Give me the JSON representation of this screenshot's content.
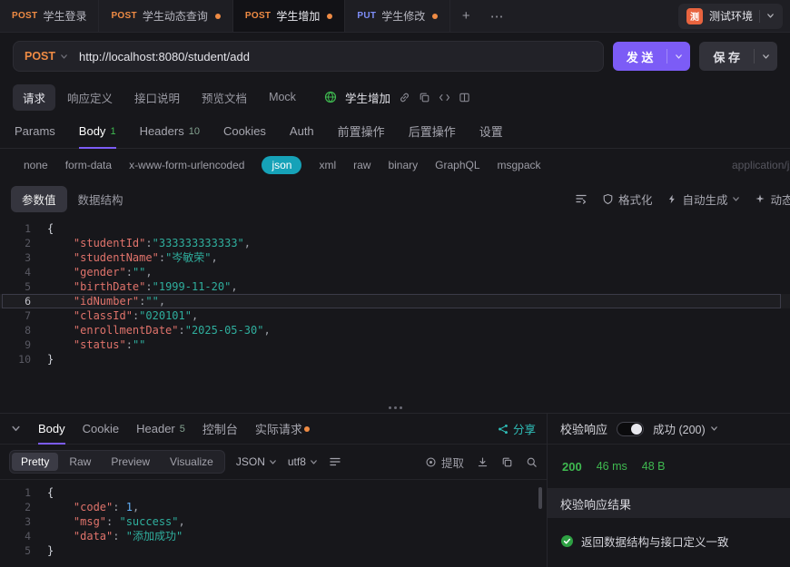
{
  "colors": {
    "accent_purple": "#7c5cf6",
    "method_post": "#ef8b44",
    "method_put": "#7e8ef8",
    "success_green": "#3fb950",
    "json_pill": "#16a2b8",
    "share_teal": "#2fbfb9",
    "dirty_dot": "#ef8b44",
    "env_badge": "#e8643f",
    "token_key": "#e0736b",
    "token_string": "#2fae9d",
    "token_number": "#61aef5",
    "token_punct": "#9da0a8",
    "token_brace": "#cfd2d9"
  },
  "window_tabs": {
    "tabs": [
      {
        "method": "POST",
        "title": "学生登录",
        "dirty": false,
        "active": false
      },
      {
        "method": "POST",
        "title": "学生动态查询",
        "dirty": true,
        "active": false
      },
      {
        "method": "POST",
        "title": "学生增加",
        "dirty": true,
        "active": true
      },
      {
        "method": "PUT",
        "title": "学生修改",
        "dirty": true,
        "active": false
      }
    ],
    "add_button": "+",
    "more_button": "⋯",
    "environment": {
      "badge": "测",
      "name": "测试环境"
    }
  },
  "request_bar": {
    "method": "POST",
    "url": "http://localhost:8080/student/add",
    "send_label": "发 送",
    "save_label": "保 存"
  },
  "doc_nav": {
    "items": [
      {
        "label": "请求",
        "active": true
      },
      {
        "label": "响应定义",
        "active": false
      },
      {
        "label": "接口说明",
        "active": false
      },
      {
        "label": "预览文档",
        "active": false
      },
      {
        "label": "Mock",
        "active": false
      }
    ],
    "endpoint_name": "学生增加"
  },
  "request_tabs": [
    {
      "label": "Params",
      "count": "",
      "active": false
    },
    {
      "label": "Body",
      "count": "1",
      "active": true
    },
    {
      "label": "Headers",
      "count": "10",
      "active": false
    },
    {
      "label": "Cookies",
      "count": "",
      "active": false
    },
    {
      "label": "Auth",
      "count": "",
      "active": false
    },
    {
      "label": "前置操作",
      "count": "",
      "active": false
    },
    {
      "label": "后置操作",
      "count": "",
      "active": false
    },
    {
      "label": "设置",
      "count": "",
      "active": false
    }
  ],
  "body_type_tabs": [
    {
      "label": "none",
      "active": false
    },
    {
      "label": "form-data",
      "active": false
    },
    {
      "label": "x-www-form-urlencoded",
      "active": false
    },
    {
      "label": "json",
      "active": true
    },
    {
      "label": "xml",
      "active": false
    },
    {
      "label": "raw",
      "active": false
    },
    {
      "label": "binary",
      "active": false
    },
    {
      "label": "GraphQL",
      "active": false
    },
    {
      "label": "msgpack",
      "active": false
    }
  ],
  "content_type_hint": "application/json",
  "editor_toolbar": {
    "value_tab": "参数值",
    "schema_tab": "数据结构",
    "format_label": "格式化",
    "autogen_label": "自动生成",
    "dynamic_label": "动态值"
  },
  "request_editor": {
    "active_line": 6,
    "lines": [
      {
        "num": "1",
        "tokens": [
          [
            "br",
            "{"
          ]
        ]
      },
      {
        "num": "2",
        "tokens": [
          [
            "ws",
            "    "
          ],
          [
            "key",
            "\"studentId\""
          ],
          [
            "pun",
            ":"
          ],
          [
            "str",
            "\"333333333333\""
          ],
          [
            "pun",
            ","
          ]
        ]
      },
      {
        "num": "3",
        "tokens": [
          [
            "ws",
            "    "
          ],
          [
            "key",
            "\"studentName\""
          ],
          [
            "pun",
            ":"
          ],
          [
            "str",
            "\"岑敏荣\""
          ],
          [
            "pun",
            ","
          ]
        ]
      },
      {
        "num": "4",
        "tokens": [
          [
            "ws",
            "    "
          ],
          [
            "key",
            "\"gender\""
          ],
          [
            "pun",
            ":"
          ],
          [
            "str",
            "\"\""
          ],
          [
            "pun",
            ","
          ]
        ]
      },
      {
        "num": "5",
        "tokens": [
          [
            "ws",
            "    "
          ],
          [
            "key",
            "\"birthDate\""
          ],
          [
            "pun",
            ":"
          ],
          [
            "str",
            "\"1999-11-20\""
          ],
          [
            "pun",
            ","
          ]
        ]
      },
      {
        "num": "6",
        "tokens": [
          [
            "ws",
            "    "
          ],
          [
            "key",
            "\"idNumber\""
          ],
          [
            "pun",
            ":"
          ],
          [
            "str",
            "\"\""
          ],
          [
            "pun",
            ","
          ]
        ]
      },
      {
        "num": "7",
        "tokens": [
          [
            "ws",
            "    "
          ],
          [
            "key",
            "\"classId\""
          ],
          [
            "pun",
            ":"
          ],
          [
            "str",
            "\"020101\""
          ],
          [
            "pun",
            ","
          ]
        ]
      },
      {
        "num": "8",
        "tokens": [
          [
            "ws",
            "    "
          ],
          [
            "key",
            "\"enrollmentDate\""
          ],
          [
            "pun",
            ":"
          ],
          [
            "str",
            "\"2025-05-30\""
          ],
          [
            "pun",
            ","
          ]
        ]
      },
      {
        "num": "9",
        "tokens": [
          [
            "ws",
            "    "
          ],
          [
            "key",
            "\"status\""
          ],
          [
            "pun",
            ":"
          ],
          [
            "str",
            "\"\""
          ]
        ]
      },
      {
        "num": "10",
        "tokens": [
          [
            "br",
            "}"
          ]
        ]
      }
    ]
  },
  "response": {
    "tabs": [
      {
        "label": "Body",
        "count": "",
        "active": true,
        "dirty": false
      },
      {
        "label": "Cookie",
        "count": "",
        "active": false,
        "dirty": false
      },
      {
        "label": "Header",
        "count": "5",
        "active": false,
        "dirty": false
      },
      {
        "label": "控制台",
        "count": "",
        "active": false,
        "dirty": false
      },
      {
        "label": "实际请求",
        "count": "",
        "active": false,
        "dirty": true
      }
    ],
    "share_label": "分享",
    "view_tabs": [
      {
        "label": "Pretty",
        "active": true
      },
      {
        "label": "Raw",
        "active": false
      },
      {
        "label": "Preview",
        "active": false
      },
      {
        "label": "Visualize",
        "active": false
      }
    ],
    "lang_select": "JSON",
    "encoding_select": "utf8",
    "extract_label": "提取",
    "editor": {
      "lines": [
        {
          "num": "1",
          "tokens": [
            [
              "br",
              "{"
            ]
          ]
        },
        {
          "num": "2",
          "tokens": [
            [
              "ws",
              "    "
            ],
            [
              "key",
              "\"code\""
            ],
            [
              "pun",
              ": "
            ],
            [
              "num",
              "1"
            ],
            [
              "pun",
              ","
            ]
          ]
        },
        {
          "num": "3",
          "tokens": [
            [
              "ws",
              "    "
            ],
            [
              "key",
              "\"msg\""
            ],
            [
              "pun",
              ": "
            ],
            [
              "str",
              "\"success\""
            ],
            [
              "pun",
              ","
            ]
          ]
        },
        {
          "num": "4",
          "tokens": [
            [
              "ws",
              "    "
            ],
            [
              "key",
              "\"data\""
            ],
            [
              "pun",
              ": "
            ],
            [
              "str",
              "\"添加成功\""
            ]
          ]
        },
        {
          "num": "5",
          "tokens": [
            [
              "br",
              "}"
            ]
          ]
        }
      ]
    }
  },
  "validation": {
    "header_label": "校验响应",
    "toggle_on": true,
    "result_select": "成功 (200)",
    "status_code": "200",
    "time": "46 ms",
    "size": "48 B",
    "panel_title": "校验响应结果",
    "panel_message": "返回数据结构与接口定义一致"
  }
}
